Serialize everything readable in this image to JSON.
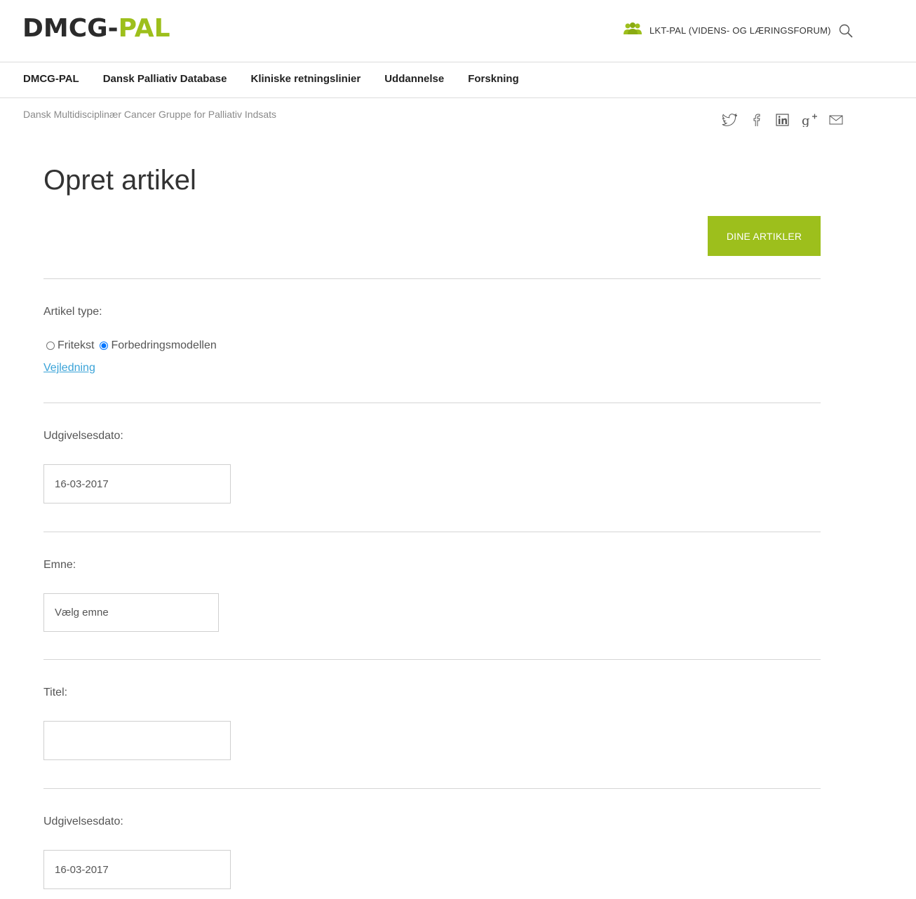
{
  "header": {
    "logo_part1": "DMCG-",
    "logo_part2": "PAL",
    "forum_link": "LKT-PAL (VIDENS- OG LÆRINGSFORUM)",
    "colors": {
      "accent": "#9dbf1c",
      "dark": "#2b2b2b",
      "link": "#3aa3d8"
    }
  },
  "nav": {
    "items": [
      {
        "label": "DMCG-PAL"
      },
      {
        "label": "Dansk Palliativ Database"
      },
      {
        "label": "Kliniske retningslinier"
      },
      {
        "label": "Uddannelse"
      },
      {
        "label": "Forskning"
      }
    ]
  },
  "subtitle": "Dansk Multidisciplinær Cancer Gruppe for Palliativ Indsats",
  "social_icons": [
    "twitter-icon",
    "facebook-icon",
    "linkedin-icon",
    "google-plus-icon",
    "mail-icon"
  ],
  "page": {
    "title": "Opret artikel",
    "articles_button": "DINE ARTIKLER"
  },
  "form": {
    "article_type": {
      "label": "Artikel type:",
      "options": [
        "Fritekst",
        "Forbedringsmodellen"
      ],
      "selected": "Forbedringsmodellen",
      "guide_link": "Vejledning"
    },
    "publish_date": {
      "label": "Udgivelsesdato:",
      "value": "16-03-2017"
    },
    "topic": {
      "label": "Emne:",
      "value": "Vælg emne"
    },
    "title": {
      "label": "Titel:",
      "value": ""
    },
    "publish_date_2": {
      "label": "Udgivelsesdato:",
      "value": "16-03-2017"
    }
  }
}
